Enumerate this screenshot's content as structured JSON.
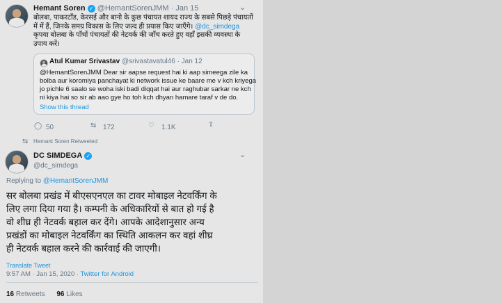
{
  "top_tweet": {
    "name": "Hemant Soren",
    "handle_date": "@HemantSorenJMM · Jan 15",
    "text_line1": "बोलबा, पाकरटाँड, केरसई और बानो के कुछ पंचायत शायद राज्य के सबसे पिछड़े पंचायतों",
    "text_line2": "में में हैं, जिनके समग्र विकास के लिए जल्द ही प्रयास किए जाएँगे।",
    "mention": " @dc_simdega",
    "text_line3": "कृपया बोलबा के पाँचों पंचायतों की नेटवर्क की जाँच करते हुए वहाँ इसकी व्यवस्था के",
    "text_line4": "उपाय करें।",
    "quote": {
      "name": "Atul Kumar Srivastav",
      "handle_date": "@srivastavatul46 · Jan 12",
      "lines": [
        "@HemantSorenJMM Dear sir aapse request hai ki aap simeega zile ka",
        "bolba aur koromiya panchayat ki network issue ke baare me v kch kriyega",
        "jo pichle 6 saalo se woha iski badi diqqat hai aur raghubar sarkar ne kch",
        "ni kiya hai so sir ab aao gye ho toh kch dhyan hamare taraf v de do."
      ],
      "show_thread": "Show this thread"
    },
    "replies": "50",
    "retweets": "172",
    "likes": "1.1K",
    "reply_icon": "reply-icon",
    "retweet_icon": "retweet-icon",
    "like_icon": "heart-icon",
    "share_icon": "share-icon"
  },
  "retweet_notice": "Hemant Soren Retweeted",
  "reply_tweet": {
    "name": "DC SIMDEGA",
    "handle": "@dc_simdega",
    "replying_to_prefix": "Replying to ",
    "replying_to": "@HemantSorenJMM",
    "lines": [
      "सर बोलबा प्रखंड में बीएसएनएल का टावर मोबाइल नेटवर्किंग के",
      "लिए लगा दिया गया है। कम्पनी के अधिकारियों से बात हो गई है",
      "वो शीघ्र ही नेटवर्क बहाल कर देंगे। आपके आदेशानुसार अन्य",
      "प्रखंडों का मोबाइल नेटवर्किंग का स्थिति आकलन कर वहां शीघ्र",
      "ही नेटवर्क बहाल करने की कार्रवाई की जाएगी।"
    ],
    "translate": "Translate Tweet",
    "time": "9:57 AM · Jan 15, 2020 · ",
    "source": "Twitter for Android",
    "retweets_count": "16",
    "retweets_label": "Retweets",
    "likes_count": "96",
    "likes_label": "Likes"
  },
  "colors": {
    "accent": "#1da1f2",
    "link": "#1b95e0",
    "muted": "#657786"
  }
}
